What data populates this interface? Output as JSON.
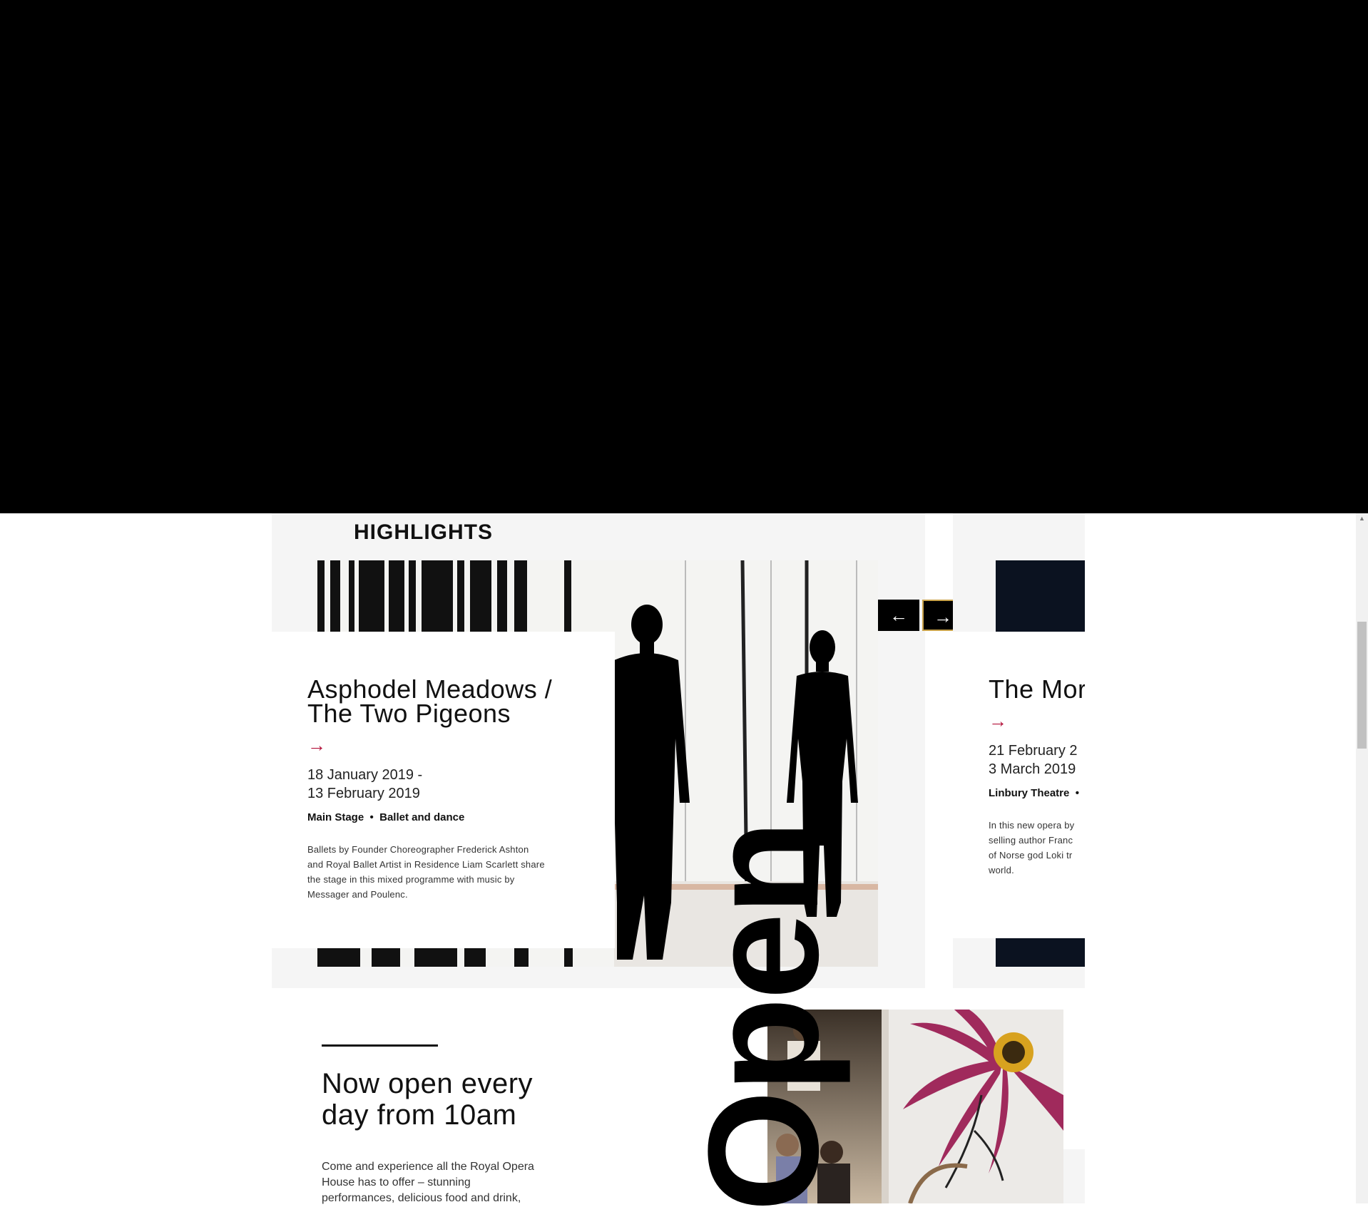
{
  "highlights": {
    "heading": "HIGHLIGHTS",
    "nav": {
      "prev_icon": "arrow-left-icon",
      "next_icon": "arrow-right-icon",
      "prev_glyph": "←",
      "next_glyph": "→"
    },
    "cards": [
      {
        "title_line1": "Asphodel Meadows /",
        "title_line2": "The Two Pigeons",
        "arrow": "→",
        "date_line1": "18 January 2019 -",
        "date_line2": "13 February 2019",
        "venue": "Main Stage",
        "category": "Ballet and dance",
        "desc_line1": "Ballets by Founder Choreographer Frederick Ashton",
        "desc_line2": "and Royal Ballet Artist in Residence Liam Scarlett share",
        "desc_line3": "the stage in this mixed programme with music by",
        "desc_line4": "Messager and Poulenc."
      },
      {
        "title_line1": "The Mor",
        "arrow": "→",
        "date_line1": "21 February 2",
        "date_line2": "3 March 2019",
        "venue": "Linbury Theatre",
        "desc_line1": "In this new opera by",
        "desc_line2": "selling author Franc",
        "desc_line3": "of Norse god Loki tr",
        "desc_line4": "world."
      }
    ]
  },
  "open": {
    "title_line1": "Now open every",
    "title_line2": "day from 10am",
    "body_line1": "Come and experience all the Royal Opera",
    "body_line2": "House has to offer – stunning",
    "body_line3": "performances, delicious food and drink,",
    "big_word": "Open"
  },
  "colors": {
    "accent_red": "#b3123a",
    "nav_border": "#c9a24a",
    "panel_bg": "#f5f5f5"
  }
}
